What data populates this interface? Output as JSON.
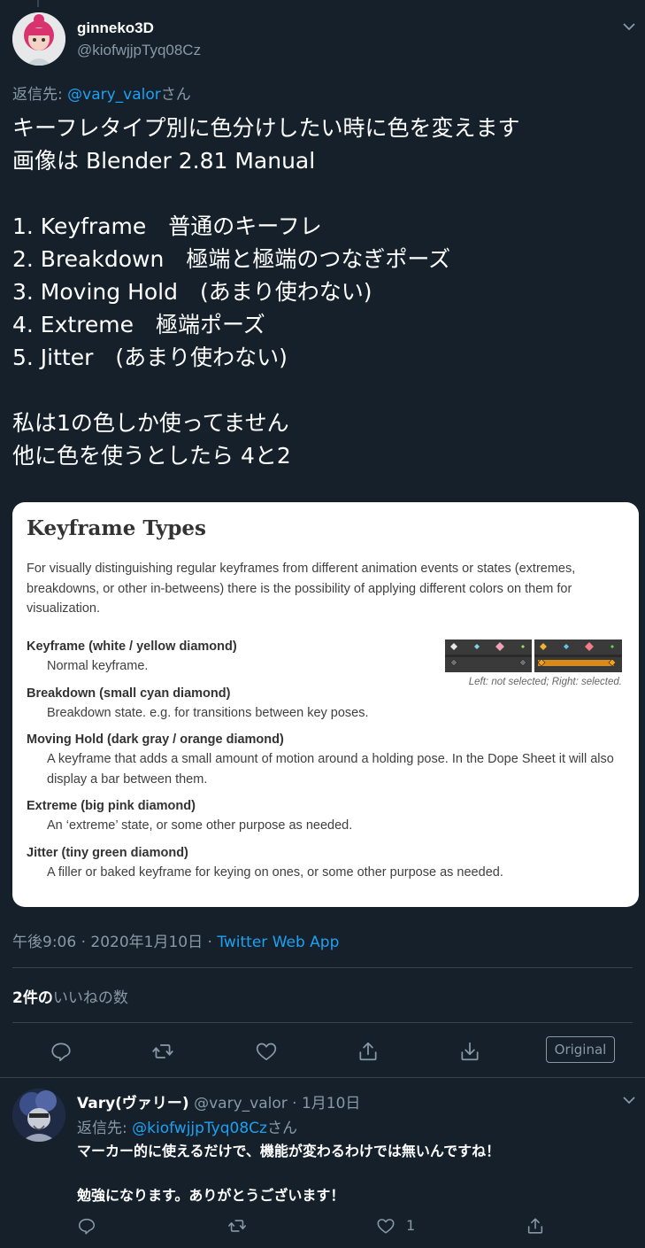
{
  "tweet": {
    "author_name": "ginneko3D",
    "author_handle": "@kiofwjjpTyq08Cz",
    "reply_prefix": "返信先: ",
    "reply_to": "@vary_valor",
    "reply_suffix": "さん",
    "text": "キーフレタイプ別に色分けしたい時に色を変えます\n画像は Blender 2.81 Manual\n\n1. Keyframe　普通のキーフレ\n2. Breakdown　極端と極端のつなぎポーズ\n3. Moving Hold　(あまり使わない)\n4. Extreme　極端ポーズ\n5. Jitter　(あまり使わない)\n\n私は1の色しか使ってません\n他に色を使うとしたら 4と2",
    "timestamp": "午後9:06 · 2020年1月10日 · ",
    "source_app": "Twitter Web App",
    "likes_count": "2件の",
    "likes_label": "いいねの数",
    "original_label": "Original"
  },
  "attached_image": {
    "title": "Keyframe Types",
    "intro": "For visually distinguishing regular keyframes from different animation events or states (extremes, breakdowns, or other in-betweens) there is the possibility of applying different colors on them for visualization.",
    "caption": "Left: not selected; Right: selected.",
    "types": [
      {
        "term": "Keyframe (white / yellow diamond)",
        "def": "Normal keyframe."
      },
      {
        "term": "Breakdown (small cyan diamond)",
        "def": "Breakdown state. e.g. for transitions between key poses."
      },
      {
        "term": "Moving Hold (dark gray / orange diamond)",
        "def": "A keyframe that adds a small amount of motion around a holding pose. In the Dope Sheet it will also display a bar between them."
      },
      {
        "term": "Extreme (big pink diamond)",
        "def": "An ‘extreme’ state, or some other purpose as needed."
      },
      {
        "term": "Jitter (tiny green diamond)",
        "def": "A filler or baked keyframe for keying on ones, or some other purpose as needed."
      }
    ]
  },
  "reply": {
    "author_name": "Vary(ヴァリー)",
    "author_handle": "@vary_valor",
    "date": " · 1月10日",
    "reply_prefix": "返信先: ",
    "reply_to": "@kiofwjjpTyq08Cz",
    "reply_suffix": "さん",
    "text": "マーカー的に使えるだけで、機能が変わるわけでは無いんですね！\n\n勉強になります。ありがとうございます！",
    "like_count": "1"
  },
  "colors": {
    "background": "#15202b",
    "secondary_text": "#8899a6",
    "link": "#1da1f2",
    "divider": "#38444d"
  },
  "icons": [
    "chevron-down-icon",
    "reply-icon",
    "retweet-icon",
    "like-icon",
    "share-icon",
    "download-icon"
  ]
}
